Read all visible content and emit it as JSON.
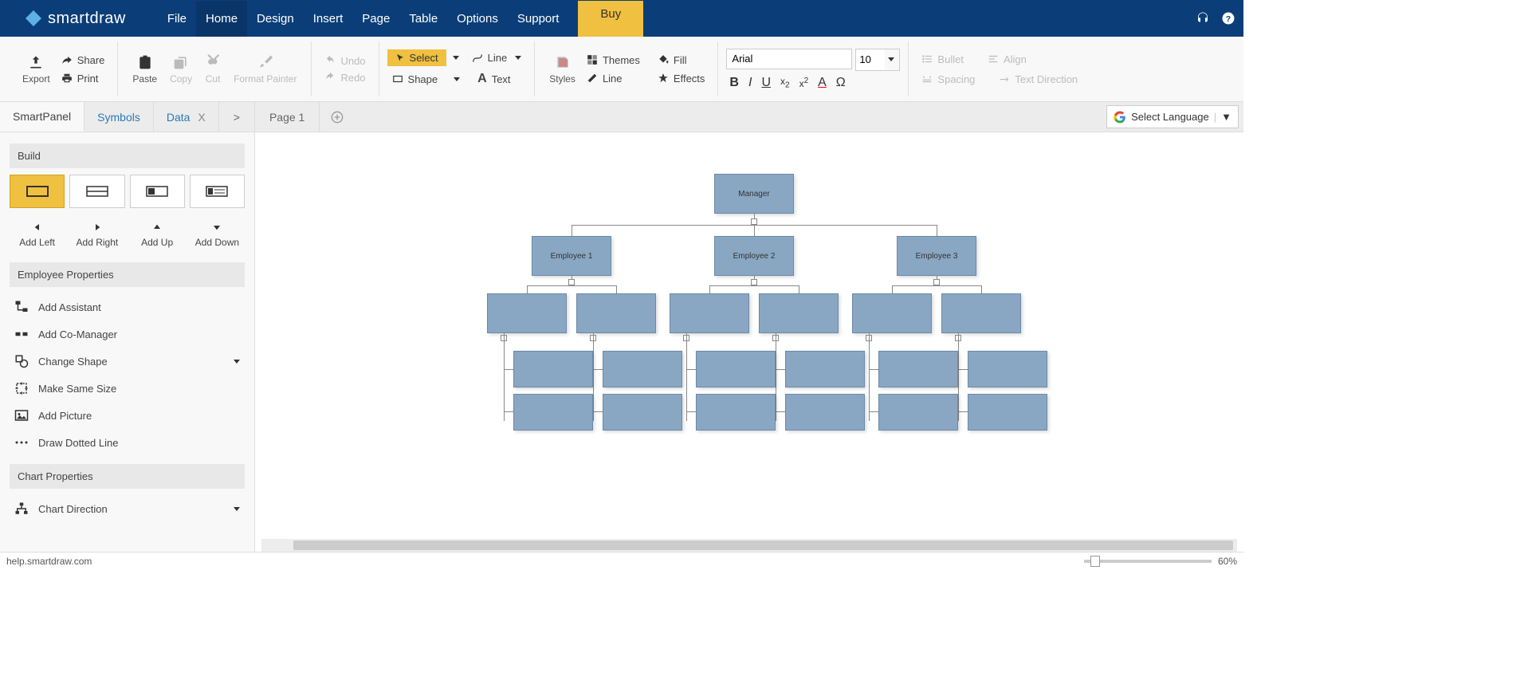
{
  "app": {
    "name": "smartdraw"
  },
  "menu": {
    "items": [
      "File",
      "Home",
      "Design",
      "Insert",
      "Page",
      "Table",
      "Options",
      "Support"
    ],
    "active": 1,
    "buy": "Buy"
  },
  "ribbon": {
    "export": "Export",
    "share": "Share",
    "print": "Print",
    "paste": "Paste",
    "copy": "Copy",
    "cut": "Cut",
    "format_painter": "Format Painter",
    "undo": "Undo",
    "redo": "Redo",
    "select": "Select",
    "line": "Line",
    "shape": "Shape",
    "text": "Text",
    "styles": "Styles",
    "themes": "Themes",
    "fill": "Fill",
    "line2": "Line",
    "effects": "Effects",
    "font": "Arial",
    "size": "10",
    "bullet": "Bullet",
    "align": "Align",
    "spacing": "Spacing",
    "text_direction": "Text Direction"
  },
  "tabs": {
    "smartpanel": "SmartPanel",
    "symbols": "Symbols",
    "data": "Data",
    "page": "Page 1",
    "lang": "Select Language"
  },
  "side": {
    "build": "Build",
    "add_left": "Add Left",
    "add_right": "Add Right",
    "add_up": "Add Up",
    "add_down": "Add Down",
    "emp_props": "Employee Properties",
    "add_assistant": "Add Assistant",
    "add_comanager": "Add Co-Manager",
    "change_shape": "Change Shape",
    "make_same": "Make Same Size",
    "add_picture": "Add Picture",
    "draw_dotted": "Draw Dotted Line",
    "chart_props": "Chart Properties",
    "chart_dir": "Chart Direction"
  },
  "chart": {
    "manager": "Manager",
    "emp1": "Employee 1",
    "emp2": "Employee 2",
    "emp3": "Employee 3"
  },
  "status": {
    "url": "help.smartdraw.com",
    "zoom": "60%"
  }
}
